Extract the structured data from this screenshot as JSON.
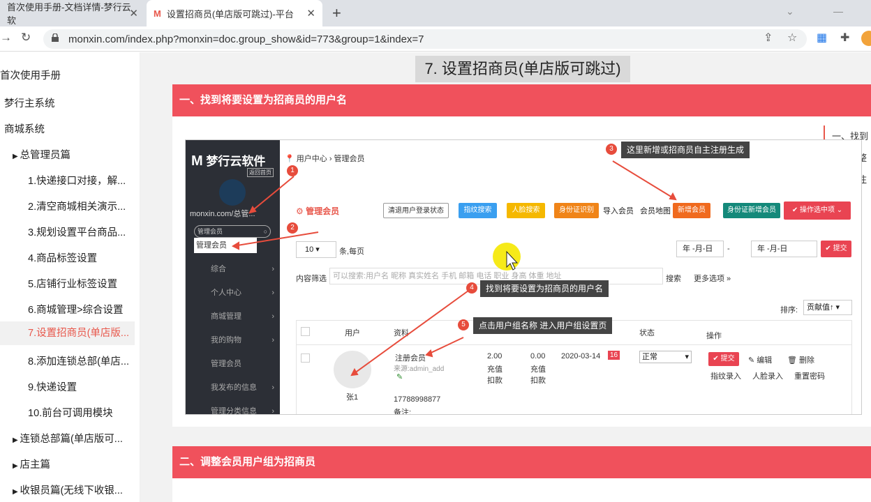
{
  "tabs": [
    {
      "label": "首次使用手册-文档详情-梦行云软"
    },
    {
      "label": "设置招商员(单店版可跳过)-平台"
    }
  ],
  "address": {
    "url": "monxin.com/index.php?monxin=doc.group_show&id=773&group=1&index=7"
  },
  "sidebar": {
    "header": "首次使用手册",
    "items": [
      {
        "label": "梦行主系统"
      },
      {
        "label": "商城系统"
      },
      {
        "label": "总管理员篇"
      },
      {
        "label": "1.快递接口对接，解..."
      },
      {
        "label": "2.清空商城相关演示..."
      },
      {
        "label": "3.规划设置平台商品..."
      },
      {
        "label": "4.商品标签设置"
      },
      {
        "label": "5.店铺行业标签设置"
      },
      {
        "label": "6.商城管理>综合设置"
      },
      {
        "label": "7.设置招商员(单店版..."
      },
      {
        "label": "8.添加连锁总部(单店..."
      },
      {
        "label": "9.快递设置"
      },
      {
        "label": "10.前台可调用模块"
      },
      {
        "label": "连锁总部篇(单店版可..."
      },
      {
        "label": "店主篇"
      },
      {
        "label": "收银员篇(无线下收银..."
      }
    ]
  },
  "doc": {
    "title": "7. 设置招商员(单店版可跳过)",
    "section1": "一、找到将要设置为招商员的用户名",
    "section2": "二、调整会员用户组为招商员",
    "toc": [
      "一、找到将",
      "二、调整会",
      "三、备注"
    ]
  },
  "shot": {
    "logo": "梦行云软件",
    "back_home": "返回首页",
    "user": "monxin.com/总管...",
    "search_placeholder": "管理会员",
    "menu_pop": "管理会员",
    "menu": [
      "综合",
      "个人中心",
      "商城管理",
      "我的购物",
      "管理会员",
      "我发布的信息",
      "管理分类信息"
    ],
    "crumb": "用户中心 › 管理会员",
    "page_title": "管理会员",
    "buttons": {
      "clear": "清退用户登录状态",
      "finger": "指纹搜索",
      "face": "人脸搜索",
      "idcard": "身份证识别",
      "import": "导入会员",
      "map": "会员地图",
      "add": "新增会员",
      "idadd": "身份证新增会员",
      "ops": "操作选中项"
    },
    "per_page": "10",
    "per_page_unit": "条,每页",
    "date_ph": "年 -月-日",
    "submit": "提交",
    "filter_label": "内容筛选",
    "filter_ph": "可以搜索:用户名 昵称 真实姓名 手机 邮箱 电话 职业 身高 体重 地址",
    "search": "搜索",
    "more": "更多选项",
    "sort_label": "排序:",
    "sort_value": "贡献值↑",
    "cols": [
      "用户",
      "资料",
      "",
      "",
      "",
      "状态",
      "操作"
    ],
    "row": {
      "name": "张1",
      "group": "注册会员",
      "source": "来源:admin_add",
      "phone": "17788998877",
      "note": "备注:",
      "balance": "2.00",
      "charge": "充值",
      "deduct": "扣款",
      "points": "0.00",
      "date": "2020-03-14",
      "badge": "16",
      "status": "正常",
      "ops": [
        "提交",
        "编辑",
        "删除",
        "指纹录入",
        "人脸录入",
        "重置密码"
      ]
    },
    "annotations": [
      {
        "n": "1"
      },
      {
        "n": "2"
      },
      {
        "n": "3",
        "text": "这里新增或招商员自主注册生成"
      },
      {
        "n": "4",
        "text": "找到将要设置为招商员的用户名"
      },
      {
        "n": "5",
        "text": "点击用户组名称   进入用户组设置页"
      }
    ]
  }
}
